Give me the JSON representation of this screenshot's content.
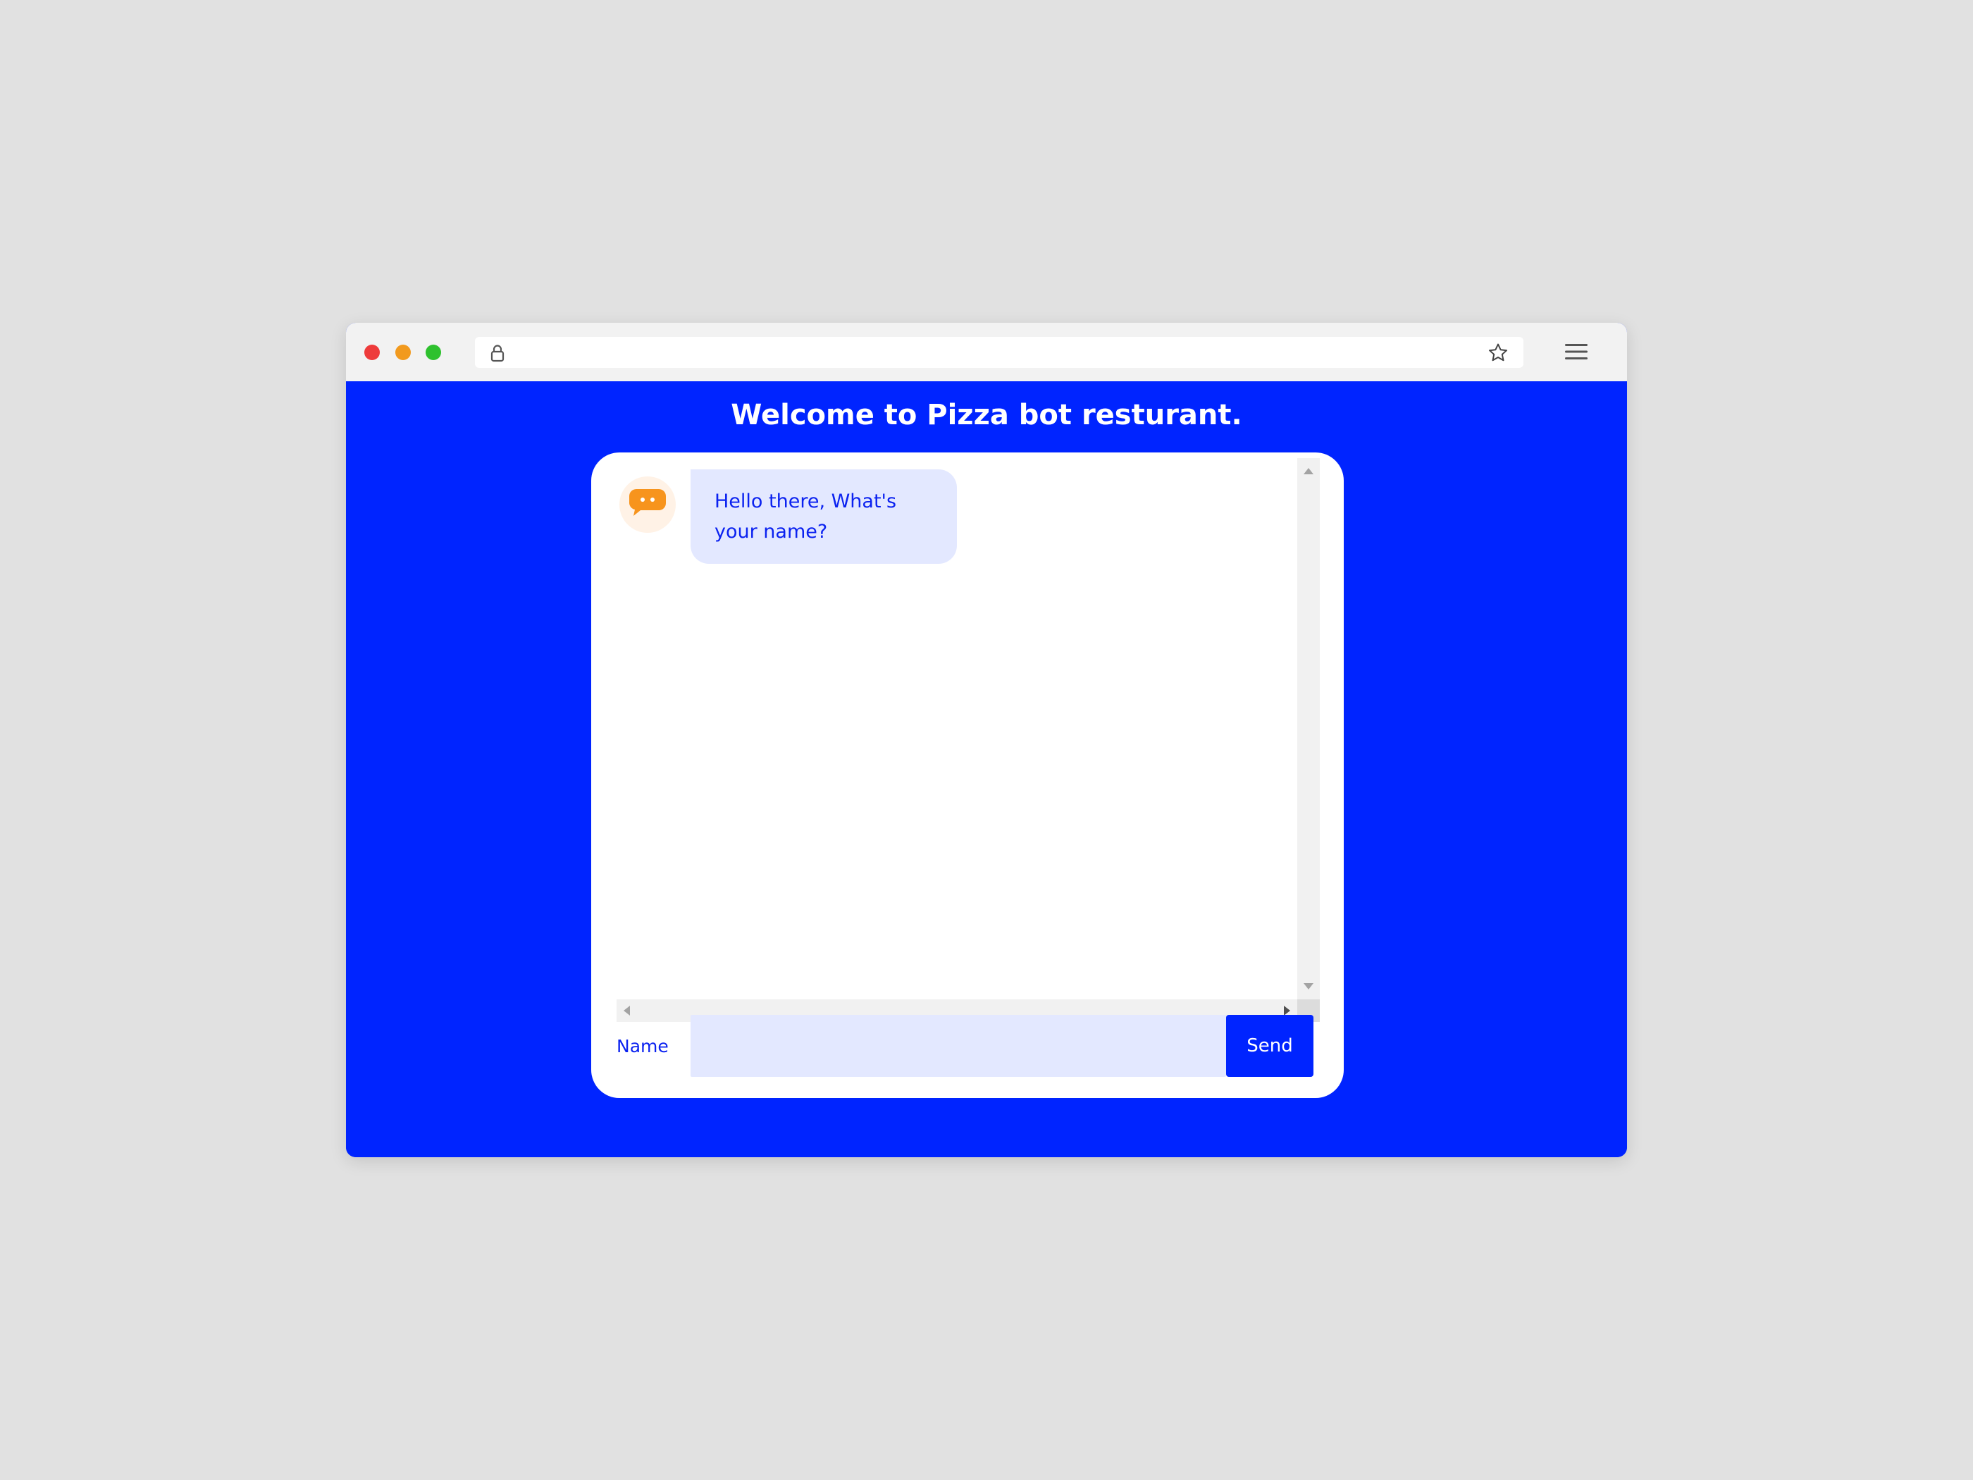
{
  "browser": {
    "url": "",
    "icons": {
      "lock": "lock-icon",
      "bookmark": "star-icon",
      "menu": "hamburger-menu-icon"
    },
    "traffic_lights": [
      "#ee3b3b",
      "#f29a1e",
      "#2ec12e"
    ]
  },
  "page": {
    "title": "Welcome to Pizza bot resturant.",
    "background_color": "#0024ff"
  },
  "chat": {
    "messages": [
      {
        "sender": "bot",
        "avatar_icon": "chat-bubble-icon",
        "text": "Hello there, What's your name?"
      }
    ],
    "input": {
      "label": "Name",
      "value": "",
      "placeholder": ""
    },
    "send_label": "Send",
    "colors": {
      "bubble": "#e3e8ff",
      "text": "#0b22f0",
      "avatar": "#f7941d"
    }
  }
}
